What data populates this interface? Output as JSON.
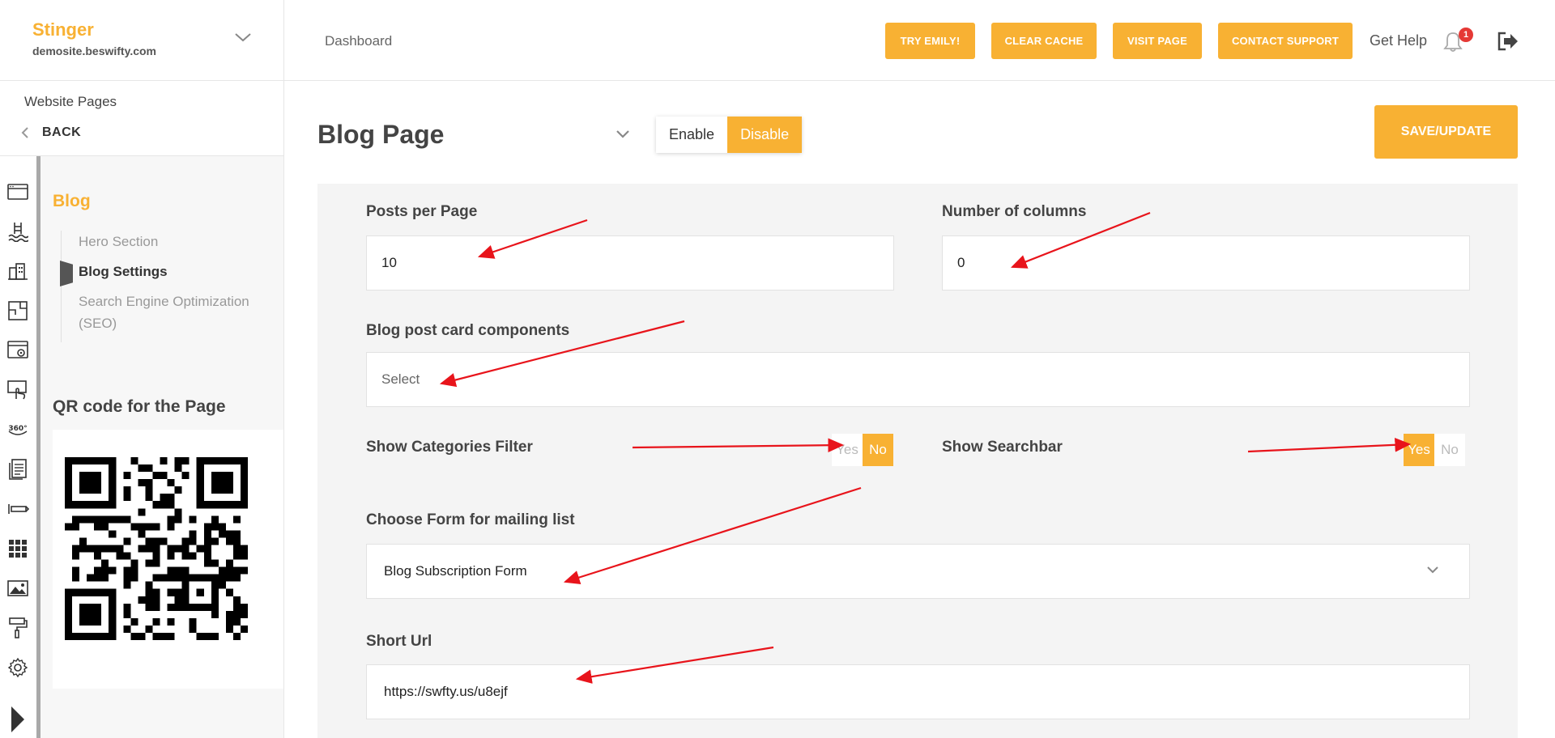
{
  "brand": {
    "name": "Stinger",
    "domain": "demosite.beswifty.com"
  },
  "sidebar": {
    "crumb_title": "Website Pages",
    "back_label": "BACK",
    "rail_icons": [
      "browser-window-icon",
      "pool-icon",
      "buildings-icon",
      "floorplan-icon",
      "web-settings-icon",
      "touch-screen-icon",
      "view-360-icon",
      "document-pages-icon",
      "pen-tool-icon",
      "grid-apps-icon",
      "image-gallery-icon",
      "paint-roller-icon",
      "gear-icon",
      "play-icon"
    ],
    "section_title": "Blog",
    "menu": [
      {
        "label": "Hero Section",
        "active": false
      },
      {
        "label": "Blog Settings",
        "active": true
      },
      {
        "label": "Search Engine Optimization (SEO)",
        "active": false
      }
    ],
    "qr_title": "QR code for the Page"
  },
  "header": {
    "title": "Dashboard",
    "buttons": [
      "TRY EMILY!",
      "CLEAR CACHE",
      "VISIT PAGE",
      "CONTACT SUPPORT"
    ],
    "help": "Get Help",
    "notification_count": "1"
  },
  "main": {
    "page_title": "Blog Page",
    "toggle": {
      "enable": "Enable",
      "disable": "Disable",
      "selected": "Disable"
    },
    "save_label": "SAVE/UPDATE",
    "fields": {
      "posts_per_page": {
        "label": "Posts per Page",
        "value": "10"
      },
      "num_columns": {
        "label": "Number of columns",
        "value": "0"
      },
      "card_components": {
        "label": "Blog post card components",
        "placeholder": "Select"
      },
      "categories_filter": {
        "label": "Show Categories Filter",
        "yes": "Yes",
        "no": "No",
        "selected": "No"
      },
      "searchbar": {
        "label": "Show Searchbar",
        "yes": "Yes",
        "no": "No",
        "selected": "Yes"
      },
      "mailing_form": {
        "label": "Choose Form for mailing list",
        "value": "Blog Subscription Form"
      },
      "short_url": {
        "label": "Short Url",
        "value": "https://swfty.us/u8ejf"
      }
    }
  },
  "colors": {
    "accent": "#f8b133",
    "annotation_arrow": "#e8141b",
    "badge": "#e53935"
  }
}
